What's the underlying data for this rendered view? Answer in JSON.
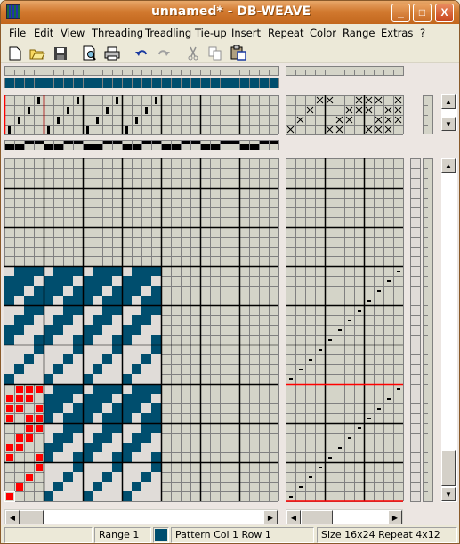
{
  "window": {
    "title": "unnamed* - DB-WEAVE",
    "controls": {
      "minimize": "_",
      "maximize": "□",
      "close": "X"
    }
  },
  "menu": [
    "File",
    "Edit",
    "View",
    "Threading",
    "Treadling",
    "Tie-up",
    "Insert",
    "Repeat",
    "Color",
    "Range",
    "Extras",
    "?"
  ],
  "toolbar": [
    {
      "name": "new-icon",
      "glyph": "🗋"
    },
    {
      "name": "open-icon",
      "glyph": "📂"
    },
    {
      "name": "save-icon",
      "glyph": "💾"
    },
    {
      "name": "print-preview-icon",
      "glyph": "🔍"
    },
    {
      "name": "print-icon",
      "glyph": "🖶"
    },
    {
      "name": "undo-icon",
      "glyph": "↶"
    },
    {
      "name": "redo-icon",
      "glyph": "↷"
    },
    {
      "name": "cut-icon",
      "glyph": "✂"
    },
    {
      "name": "copy-icon",
      "glyph": "⎘"
    },
    {
      "name": "paste-icon",
      "glyph": "📋"
    }
  ],
  "colors": {
    "pattern": "#004e6e",
    "light": "#e0dcd8",
    "grid_bg": "#d4d4c8",
    "grid_line": "#808080",
    "range": "#ff0000",
    "black": "#000000"
  },
  "threading": {
    "cols": 28,
    "rows": 4,
    "marks": [
      [
        3,
        0
      ],
      [
        7,
        0
      ],
      [
        11,
        0
      ],
      [
        15,
        0
      ],
      [
        2,
        1
      ],
      [
        6,
        1
      ],
      [
        10,
        1
      ],
      [
        14,
        1
      ],
      [
        1,
        2
      ],
      [
        5,
        2
      ],
      [
        9,
        2
      ],
      [
        13,
        2
      ],
      [
        0,
        3
      ],
      [
        4,
        3
      ],
      [
        8,
        3
      ],
      [
        12,
        3
      ]
    ]
  },
  "tieup": {
    "cols": 12,
    "rows": 4,
    "marks": [
      [
        3,
        0
      ],
      [
        4,
        0
      ],
      [
        7,
        0
      ],
      [
        8,
        0
      ],
      [
        9,
        0
      ],
      [
        11,
        0
      ],
      [
        2,
        1
      ],
      [
        6,
        1
      ],
      [
        7,
        1
      ],
      [
        8,
        1
      ],
      [
        10,
        1
      ],
      [
        11,
        1
      ],
      [
        1,
        2
      ],
      [
        5,
        2
      ],
      [
        6,
        2
      ],
      [
        9,
        2
      ],
      [
        10,
        2
      ],
      [
        11,
        2
      ],
      [
        0,
        3
      ],
      [
        4,
        3
      ],
      [
        5,
        3
      ],
      [
        8,
        3
      ],
      [
        9,
        3
      ],
      [
        10,
        3
      ]
    ]
  },
  "lift_plan_strip": {
    "cols": 28,
    "top_black": [
      2,
      3,
      6,
      7,
      10,
      11,
      14,
      15,
      18,
      19,
      22,
      23,
      26,
      27
    ]
  },
  "pattern": {
    "cols": 28,
    "rows": 35,
    "first_pattern_row": 11,
    "repeat_rows": [
      "0111",
      "1110",
      "1101",
      "1011",
      "0011",
      "0110",
      "1100",
      "1001",
      "0001",
      "0010",
      "0100",
      "1000"
    ],
    "pattern_cols": 16
  },
  "treadling": {
    "cols": 12,
    "rows": 35
  },
  "status": {
    "range": "Range 1",
    "position": "Pattern  Col 1  Row 1",
    "size": "Size 16x24  Repeat 4x12"
  }
}
